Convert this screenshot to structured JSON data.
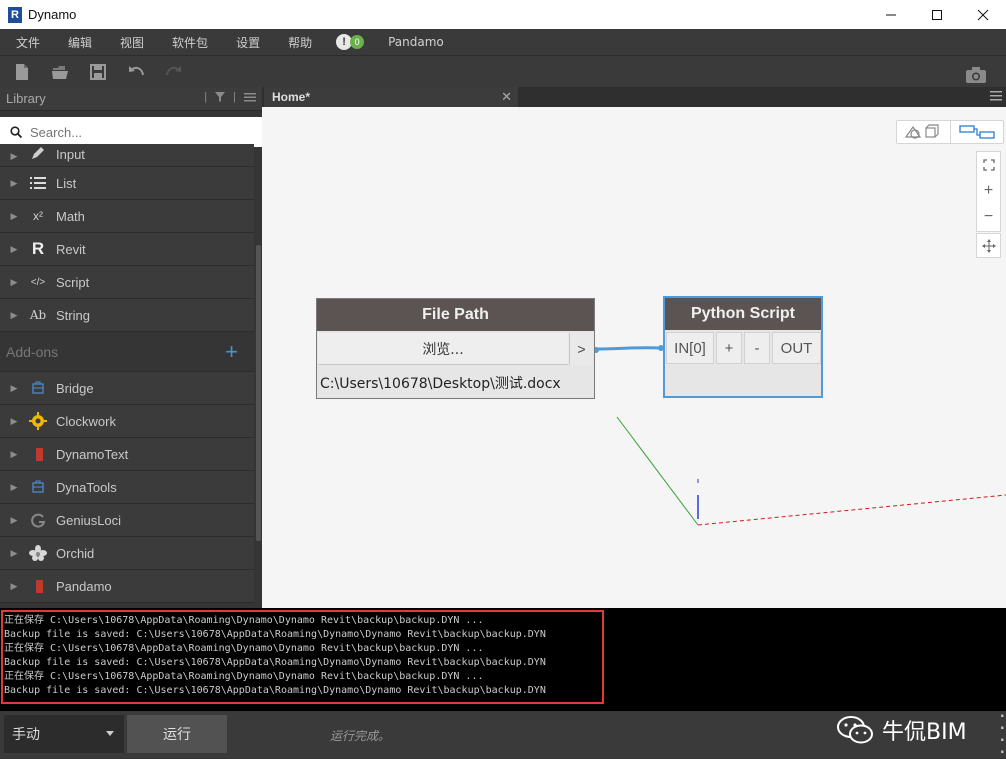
{
  "window": {
    "title": "Dynamo",
    "logo_letter": "R"
  },
  "menu": {
    "items": [
      "文件",
      "编辑",
      "视图",
      "软件包",
      "设置",
      "帮助"
    ],
    "notify_icon": "!",
    "notify_count": "0",
    "extra": "Pandamo"
  },
  "toolbar": {
    "buttons": [
      "new-file-icon",
      "open-file-icon",
      "save-icon",
      "undo-icon",
      "redo-icon",
      "screenshot-icon"
    ]
  },
  "library": {
    "title": "Library",
    "search_placeholder": "Search...",
    "core_items": [
      {
        "label": "Input",
        "icon": "pencil-icon"
      },
      {
        "label": "List",
        "icon": "list-icon"
      },
      {
        "label": "Math",
        "icon": "x2",
        "glyph": "x²"
      },
      {
        "label": "Revit",
        "icon": "revit-icon",
        "glyph": "R"
      },
      {
        "label": "Script",
        "icon": "code-icon",
        "glyph": "</>"
      },
      {
        "label": "String",
        "icon": "string-icon",
        "glyph": "Ab"
      }
    ],
    "addons_title": "Add-ons",
    "addons_add": "+",
    "addon_items": [
      {
        "label": "Bridge",
        "icon": "package-icon"
      },
      {
        "label": "Clockwork",
        "icon": "gear-icon"
      },
      {
        "label": "DynamoText",
        "icon": "book-icon"
      },
      {
        "label": "DynaTools",
        "icon": "package-icon"
      },
      {
        "label": "GeniusLoci",
        "icon": "g-icon"
      },
      {
        "label": "Orchid",
        "icon": "flower-icon"
      },
      {
        "label": "Pandamo",
        "icon": "book-icon"
      }
    ]
  },
  "tabs": [
    {
      "label": "Home*",
      "close": "✕"
    }
  ],
  "canvas": {
    "nodes": {
      "file_path": {
        "title": "File Path",
        "browse_label": "浏览...",
        "output_port": ">",
        "value": "C:\\Users\\10678\\Desktop\\测试.docx"
      },
      "python_script": {
        "title": "Python Script",
        "input_port": "IN[0]",
        "add_port": "+",
        "remove_port": "-",
        "output_port": "OUT"
      }
    },
    "zoom_controls": {
      "zoom_in": "+",
      "zoom_out": "−"
    }
  },
  "console": {
    "lines": [
      "正在保存 C:\\Users\\10678\\AppData\\Roaming\\Dynamo\\Dynamo Revit\\backup\\backup.DYN ...",
      "Backup file is saved: C:\\Users\\10678\\AppData\\Roaming\\Dynamo\\Dynamo Revit\\backup\\backup.DYN",
      "正在保存 C:\\Users\\10678\\AppData\\Roaming\\Dynamo\\Dynamo Revit\\backup\\backup.DYN ...",
      "Backup file is saved: C:\\Users\\10678\\AppData\\Roaming\\Dynamo\\Dynamo Revit\\backup\\backup.DYN",
      "正在保存 C:\\Users\\10678\\AppData\\Roaming\\Dynamo\\Dynamo Revit\\backup\\backup.DYN ...",
      "Backup file is saved: C:\\Users\\10678\\AppData\\Roaming\\Dynamo\\Dynamo Revit\\backup\\backup.DYN"
    ]
  },
  "statusbar": {
    "run_mode": "手动",
    "run_button": "运行",
    "run_status": "运行完成。",
    "watermark": "牛侃BIM"
  },
  "colors": {
    "accent": "#4f9bd9",
    "node_header": "#5c5452",
    "console_highlight": "#e03a3a",
    "addon_plus": "#4c8fd6"
  }
}
